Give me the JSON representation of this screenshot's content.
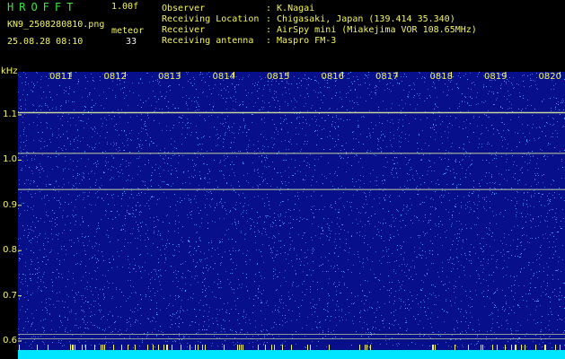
{
  "header": {
    "title": "HROFFT",
    "version": "1.00f",
    "filename": "KN9_2508280810.png",
    "mode": "meteor",
    "datetime": "25.08.28 08:10",
    "count": "33"
  },
  "info": {
    "observer_label": "Observer",
    "observer_value": ": K.Nagai",
    "location_label": "Receiving Location",
    "location_value": ": Chigasaki, Japan (139.414 35.340)",
    "receiver_label": "Receiver",
    "receiver_value": ": AirSpy mini (Miakejima VOR 108.65MHz)",
    "antenna_label": "Receiving antenna",
    "antenna_value": ": Maspro FM-3"
  },
  "chart_data": {
    "type": "heatmap",
    "ylabel": "kHz",
    "y_ticks": [
      "1.1",
      "1.0",
      "0.9",
      "0.8",
      "0.7",
      "0.6"
    ],
    "x_ticks": [
      "0811",
      "0812",
      "0813",
      "0814",
      "0815",
      "0816",
      "0817",
      "0818",
      "0819",
      "0820"
    ],
    "horizontal_lines_khz": [
      1.105,
      1.015,
      0.935,
      0.615,
      0.605
    ],
    "colors": {
      "background": "#07108a",
      "noise": "#4aa0ff",
      "line": "#e8f5a0",
      "bottom_band": "#00e5ff"
    }
  }
}
